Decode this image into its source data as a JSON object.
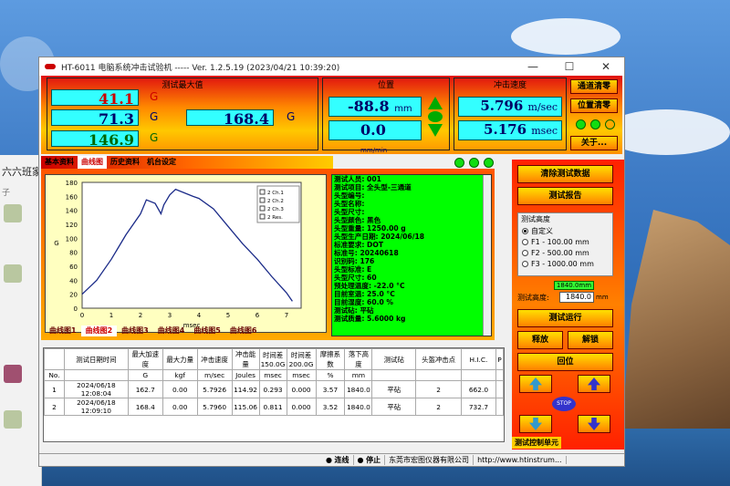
{
  "window": {
    "title": "HT-6011 电脑系统冲击试验机 ----- Ver. 1.2.5.19 (2023/04/21 10:39:20)",
    "minimize": "—",
    "maximize": "☐",
    "close": "✕"
  },
  "desktop": {
    "chat_title": "六六班家",
    "chat_sub": "子",
    "chat_items": [
      "子",
      "子"
    ]
  },
  "max_panel": {
    "title": "测试最大值",
    "r1": "41.1",
    "r2": "71.3",
    "r3": "146.9",
    "r4": "168.4",
    "unit": "G"
  },
  "pos_panel": {
    "title": "位置",
    "v1": "-88.8",
    "u1": "mm",
    "v2": "0.0",
    "u2": "mm/min"
  },
  "speed_panel": {
    "title": "冲击速度",
    "v1": "5.796",
    "u1": "m/sec",
    "v2": "5.176",
    "u2": "msec"
  },
  "top_buttons": {
    "ch_clear": "通道清零",
    "pos_clear": "位置清零",
    "about": "关于..."
  },
  "tabs": [
    "基本资料",
    "曲线图",
    "历史资料",
    "机台设定"
  ],
  "legend": [
    "2 Ch.1",
    "2 Ch.2",
    "2 Ch.3",
    "2 Res."
  ],
  "chart_data": {
    "type": "line",
    "xlabel": "msec",
    "ylabel": "G",
    "xlim": [
      0,
      7.5
    ],
    "ylim": [
      0,
      180
    ],
    "xticks": [
      "0",
      "1",
      "2",
      "3",
      "4",
      "5",
      "6",
      "7"
    ],
    "yticks": [
      "0",
      "20",
      "40",
      "60",
      "80",
      "100",
      "120",
      "140",
      "160",
      "180"
    ],
    "series": [
      {
        "name": "2 Res.",
        "x": [
          0,
          0.5,
          1,
          1.5,
          2,
          2.2,
          2.5,
          2.7,
          2.8,
          2.9,
          3.0,
          3.2,
          3.5,
          3.8,
          4,
          4.5,
          5,
          5.5,
          6,
          6.5,
          7,
          7.2
        ],
        "y": [
          20,
          40,
          70,
          105,
          135,
          155,
          150,
          135,
          148,
          155,
          162,
          170,
          165,
          160,
          157,
          142,
          117,
          92,
          70,
          45,
          22,
          10
        ]
      }
    ]
  },
  "info_lines": [
    "测试人员: 001",
    "",
    "测试项目: 全头型-三通道",
    "",
    "头型编号:",
    "头型名称:",
    "头型尺寸:",
    "头型颜色: 黑色",
    "头型重量: 1250.00 g",
    "头型生产日期: 2024/06/18",
    "标准要求: DOT",
    "标准号: 20240618",
    "识别码: 176",
    "头型标准: E",
    "头型尺寸: 60",
    "预处理温度: -22.0 °C",
    "目前室温: 25.0 °C",
    "目前湿度: 60.0 %",
    "测试砧: 平砧",
    "测试质量: 5.6000 kg"
  ],
  "subtabs": [
    "曲线图1",
    "曲线图2",
    "曲线图3",
    "曲线图4",
    "曲线图5",
    "曲线图6"
  ],
  "table": {
    "headers": [
      "",
      "测试日期时间",
      "最大加速度",
      "最大力量",
      "冲击速度",
      "冲击能量",
      "时间差 150.0G",
      "时间差 200.0G",
      "摩擦系数",
      "落下高度",
      "测试砧",
      "头盔冲击点",
      "H.I.C.",
      "P"
    ],
    "units": [
      "No.",
      "",
      "G",
      "kgf",
      "m/sec",
      "Joules",
      "msec",
      "msec",
      "%",
      "mm",
      "",
      "",
      "",
      ""
    ],
    "rows": [
      [
        "1",
        "2024/06/18 12:08:04",
        "162.7",
        "0.00",
        "5.7926",
        "114.92",
        "0.293",
        "0.000",
        "3.57",
        "1840.0",
        "平砧",
        "2",
        "662.0",
        ""
      ],
      [
        "2",
        "2024/06/18 12:09:10",
        "168.4",
        "0.00",
        "5.7960",
        "115.06",
        "0.811",
        "0.000",
        "3.52",
        "1840.0",
        "平砧",
        "2",
        "732.7",
        ""
      ]
    ]
  },
  "right": {
    "clear_data": "清除测试数据",
    "report": "测试报告",
    "height_title": "测试高度",
    "options": [
      "自定义",
      "F1 - 100.00 mm",
      "F2 - 500.00 mm",
      "F3 - 1000.00 mm",
      "F4 - 1500.00 mm"
    ],
    "height_tag": "1840.0mm",
    "height_label": "测试高度:",
    "height_value": "1840.0",
    "height_unit": "mm",
    "run": "测试运行",
    "release": "释放",
    "unlock": "解锁",
    "return": "回位",
    "stop": "STOP",
    "ctrl_unit": "测试控制单元"
  },
  "status": [
    "连线",
    "停止",
    "东莞市宏图仪器有限公司",
    "http://www.htinstrum..."
  ]
}
